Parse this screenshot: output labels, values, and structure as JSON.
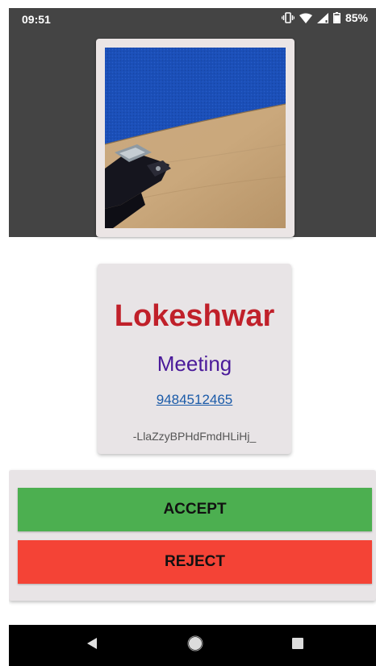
{
  "status_bar": {
    "time": "09:51",
    "battery_percent": "85%",
    "icons": [
      "vibrate-icon",
      "wifi-icon",
      "cell-signal-icon",
      "battery-icon"
    ]
  },
  "call": {
    "caller_name": "Lokeshwar",
    "call_type": "Meeting",
    "phone_number": "9484512465",
    "call_id": "-LlaZzyBPHdFmdHLiHj_"
  },
  "actions": {
    "accept_label": "ACCEPT",
    "reject_label": "REJECT"
  },
  "nav_bar": {
    "icons": [
      "back-icon",
      "home-icon",
      "recents-icon"
    ]
  },
  "colors": {
    "header_background": "#444444",
    "caller_name": "#c0202a",
    "call_type": "#4a1a9a",
    "link": "#1a5aa8",
    "accept": "#4caf50",
    "reject": "#f44336"
  }
}
